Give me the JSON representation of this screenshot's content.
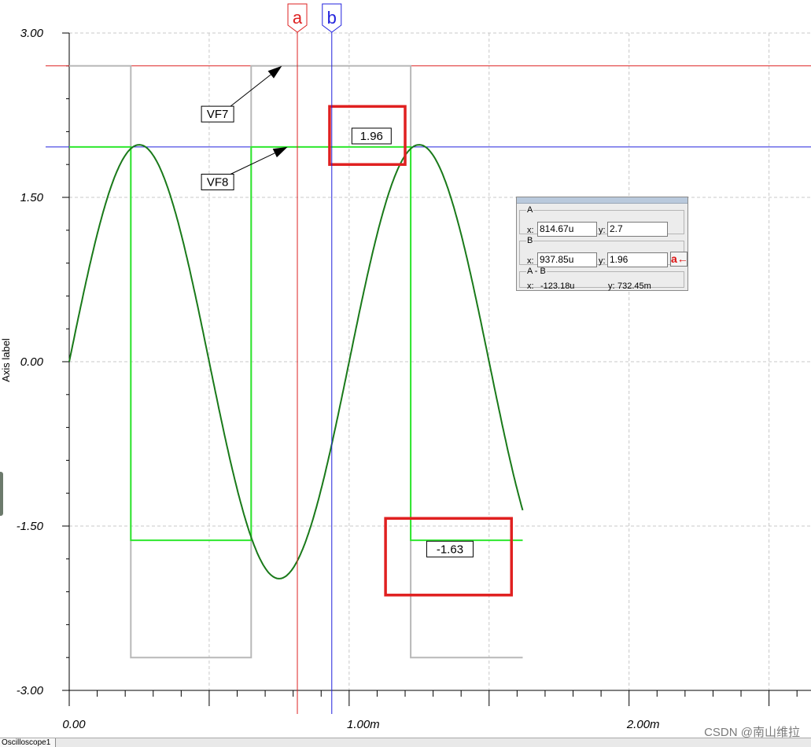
{
  "chart_data": {
    "type": "line",
    "ylabel": "Axis label",
    "xlim": [
      0,
      2.65
    ],
    "ylim": [
      -3.0,
      3.0
    ],
    "x_unit_note": "milliseconds",
    "x_ticks": [
      {
        "value": 0.0,
        "label": "0.00"
      },
      {
        "value": 1.0,
        "label": "1.00m"
      },
      {
        "value": 2.0,
        "label": "2.00m"
      }
    ],
    "y_ticks": [
      {
        "value": 3.0,
        "label": "3.00"
      },
      {
        "value": 1.5,
        "label": "1.50"
      },
      {
        "value": 0.0,
        "label": "0.00"
      },
      {
        "value": -1.5,
        "label": "-1.50"
      },
      {
        "value": -3.0,
        "label": "-3.00"
      }
    ],
    "grid": true,
    "series": [
      {
        "kind": "sine",
        "color": "#1a7a1a",
        "x": [
          0.0,
          0.1,
          0.2,
          0.25,
          0.3,
          0.4,
          0.5,
          0.6,
          0.7,
          0.75,
          0.8,
          0.9,
          1.0,
          1.1,
          1.2,
          1.25,
          1.3,
          1.4,
          1.5,
          1.62
        ],
        "y": [
          0.0,
          1.16,
          1.88,
          1.98,
          1.88,
          1.16,
          0.0,
          -1.16,
          -1.88,
          -1.98,
          -1.88,
          -1.16,
          0.0,
          1.16,
          1.88,
          1.98,
          1.88,
          1.16,
          0.0,
          -1.42
        ]
      },
      {
        "kind": "square",
        "color": "#2ee82e",
        "x": [
          0.0,
          0.22,
          0.22,
          0.65,
          0.65,
          1.22,
          1.22,
          1.62
        ],
        "y": [
          1.96,
          1.96,
          -1.63,
          -1.63,
          1.96,
          1.96,
          -1.63,
          -1.63
        ]
      },
      {
        "kind": "square",
        "color": "#b8b8b8",
        "x": [
          0.0,
          0.22,
          0.22,
          0.65,
          0.65,
          1.22,
          1.22,
          1.62
        ],
        "y": [
          2.7,
          2.7,
          -2.7,
          -2.7,
          2.7,
          2.7,
          -2.7,
          -2.7
        ]
      }
    ],
    "reference_lines": [
      {
        "y": 2.7,
        "color": "#dd2222"
      },
      {
        "y": 1.96,
        "color": "#2222dd"
      }
    ],
    "cursors": [
      {
        "label": "a",
        "x": 0.815,
        "color": "#dd2222"
      },
      {
        "label": "b",
        "x": 0.938,
        "color": "#2222dd"
      }
    ],
    "annotations": [
      {
        "text": "VF7",
        "label_x": 0.53,
        "label_y": 2.26,
        "target_x": 0.76,
        "target_y": 2.7
      },
      {
        "text": "VF8",
        "label_x": 0.53,
        "label_y": 1.64,
        "target_x": 0.78,
        "target_y": 1.96
      },
      {
        "text": "1.96",
        "label_x": 1.08,
        "label_y": 2.06
      },
      {
        "text": "-1.63",
        "label_x": 1.36,
        "label_y": -1.71
      }
    ],
    "highlight_boxes": [
      {
        "x0": 0.93,
        "x1": 1.2,
        "y0": 1.8,
        "y1": 2.33,
        "color": "#e02020"
      },
      {
        "x0": 1.13,
        "x1": 1.58,
        "y0": -2.13,
        "y1": -1.43,
        "color": "#e02020"
      }
    ]
  },
  "readout": {
    "group_a_label": "A",
    "group_b_label": "B",
    "group_diff_label": "A - B",
    "x_prefix": "x:",
    "y_prefix": "y:",
    "a_x": "814.67u",
    "a_y": "2.7",
    "b_x": "937.85u",
    "b_y": "1.96",
    "diff_x": "-123.18u",
    "diff_y": "732.45m",
    "swap_button_label": "a←"
  },
  "tab_label": "Oscilloscope1",
  "watermark": "CSDN @南山维拉"
}
